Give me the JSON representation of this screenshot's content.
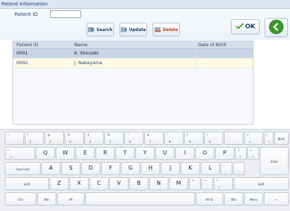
{
  "window": {
    "title": "Patient Information"
  },
  "search": {
    "label": "Patient ID",
    "value": ""
  },
  "toolbar": {
    "search": "Search",
    "update": "Update",
    "delete": "Delete",
    "ok": "OK"
  },
  "grid": {
    "headers": [
      "Patient ID",
      "Name",
      "Date of Birth"
    ],
    "rows": [
      {
        "id": "0001",
        "name": "K. Shinzaki",
        "dob": ""
      },
      {
        "id": "0002",
        "name": "J. Nakayama",
        "dob": ""
      }
    ]
  },
  "keyboard": {
    "row1": [
      {
        "top": "~",
        "bottom": "`"
      },
      {
        "top": "!",
        "bottom": "1"
      },
      {
        "top": "@",
        "bottom": "2"
      },
      {
        "top": "#",
        "bottom": "3"
      },
      {
        "top": "$",
        "bottom": "4"
      },
      {
        "top": "%",
        "bottom": "5"
      },
      {
        "top": "^",
        "bottom": "6"
      },
      {
        "top": "&",
        "bottom": "7"
      },
      {
        "top": "*",
        "bottom": "8"
      },
      {
        "top": "(",
        "bottom": "9"
      },
      {
        "top": ")",
        "bottom": "0"
      },
      {
        "top": "_",
        "bottom": "-"
      },
      {
        "top": "+",
        "bottom": "="
      },
      {
        "top": "|",
        "bottom": "\\"
      }
    ],
    "back": "Back",
    "tab_top": "←",
    "tab_bottom": "→",
    "row2": [
      "Q",
      "W",
      "E",
      "R",
      "T",
      "Y",
      "U",
      "I",
      "O",
      "P"
    ],
    "row2_extra": [
      {
        "top": "{",
        "bottom": "["
      },
      {
        "top": "}",
        "bottom": "]"
      }
    ],
    "enter": "Enter",
    "caps": "Caps Lock",
    "row3": [
      "A",
      "S",
      "D",
      "F",
      "G",
      "H",
      "J",
      "K",
      "L"
    ],
    "row3_extra": [
      {
        "top": ":",
        "bottom": ";"
      },
      {
        "top": "\"",
        "bottom": "'"
      }
    ],
    "shift": "Shift",
    "row4": [
      "Z",
      "X",
      "C",
      "V",
      "B",
      "N",
      "M"
    ],
    "row4_extra": [
      {
        "top": "<",
        "bottom": ","
      },
      {
        "top": ">",
        "bottom": "."
      },
      {
        "top": "?",
        "bottom": "/"
      }
    ],
    "ctrl": "Ctrl",
    "win": "Win",
    "alt": "Alt",
    "altgr": "Alt Gr",
    "menu": "Menu",
    "arrow": "→"
  },
  "colors": {
    "accent": "#1f3c66",
    "ok_check": "#4caf2a",
    "exit_green": "#3a9a2c",
    "delete_red": "#c43b1b"
  }
}
